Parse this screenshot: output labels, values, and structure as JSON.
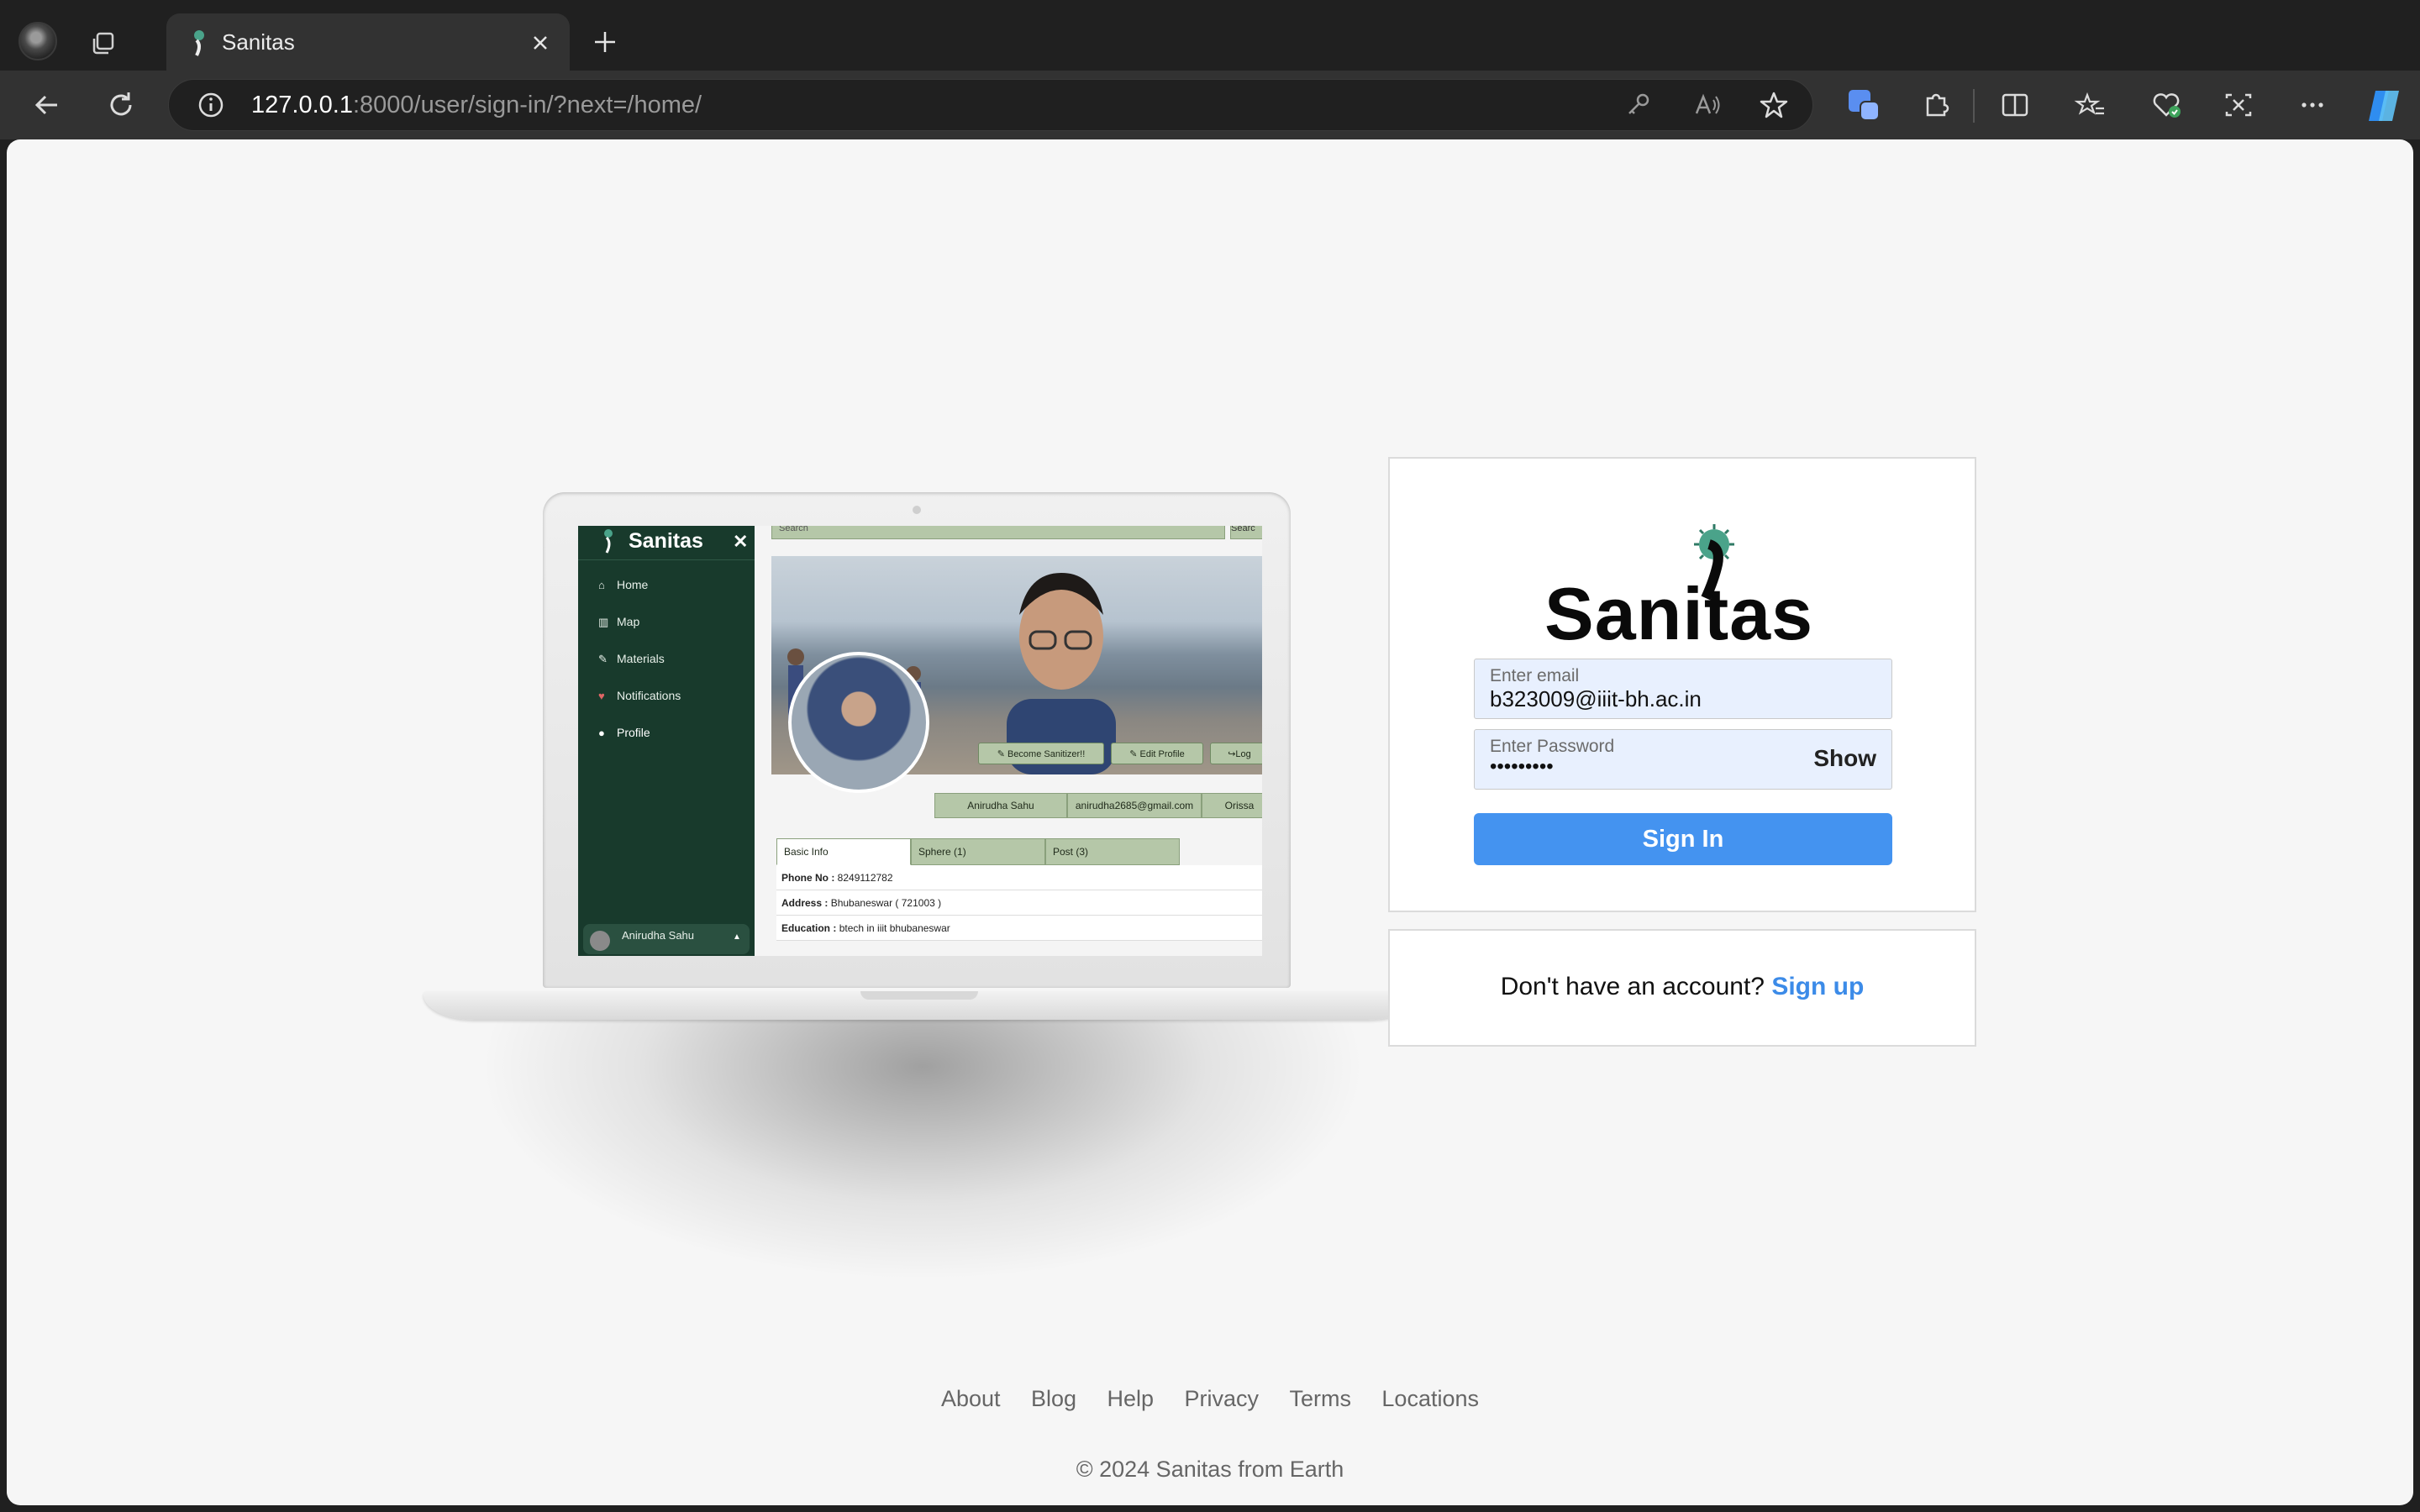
{
  "browser": {
    "tab_title": "Sanitas",
    "url_host": "127.0.0.1",
    "url_rest": ":8000/user/sign-in/?next=/home/"
  },
  "laptop_screen": {
    "brand": "Sanitas",
    "close_glyph": "✕",
    "search_placeholder": "Search",
    "search_button": "Searc",
    "nav": [
      {
        "label": "Home",
        "icon": "home-icon",
        "glyph": "⌂"
      },
      {
        "label": "Map",
        "icon": "map-icon",
        "glyph": "▥"
      },
      {
        "label": "Materials",
        "icon": "pin-icon",
        "glyph": "✎"
      },
      {
        "label": "Notifications",
        "icon": "heart-icon",
        "glyph": "♥"
      },
      {
        "label": "Profile",
        "icon": "user-icon",
        "glyph": "●"
      }
    ],
    "user_name": "Anirudha Sahu",
    "user_caret": "▲",
    "buttons": {
      "become": "✎ Become Sanitizer!!",
      "edit": "✎ Edit Profile",
      "logout": "↪Log"
    },
    "info": {
      "name": "Anirudha Sahu",
      "email": "anirudha2685@gmail.com",
      "state": "Orissa"
    },
    "tabs": [
      "Basic Info",
      "Sphere (1)",
      "Post (3)"
    ],
    "rows": [
      {
        "label": "Phone No :",
        "value": "8249112782"
      },
      {
        "label": "Address :",
        "value": "Bhubaneswar ( 721003 )"
      },
      {
        "label": "Education :",
        "value": "btech in iiit bhubaneswar"
      }
    ]
  },
  "login": {
    "logo_text": "Sanitas",
    "email_label": "Enter email",
    "email_value": "b323009@iiit-bh.ac.in",
    "password_label": "Enter Password",
    "password_value": "•••••••••",
    "show_label": "Show",
    "signin_label": "Sign In"
  },
  "signup": {
    "prompt": "Don't have an account?",
    "link": "Sign up"
  },
  "footer": {
    "links": [
      "About",
      "Blog",
      "Help",
      "Privacy",
      "Terms",
      "Locations"
    ],
    "copyright": "© 2024 Sanitas from Earth"
  },
  "colors": {
    "accent": "#4493f0",
    "sidebar_green": "#183a2c",
    "link_blue": "#3c8be8"
  }
}
